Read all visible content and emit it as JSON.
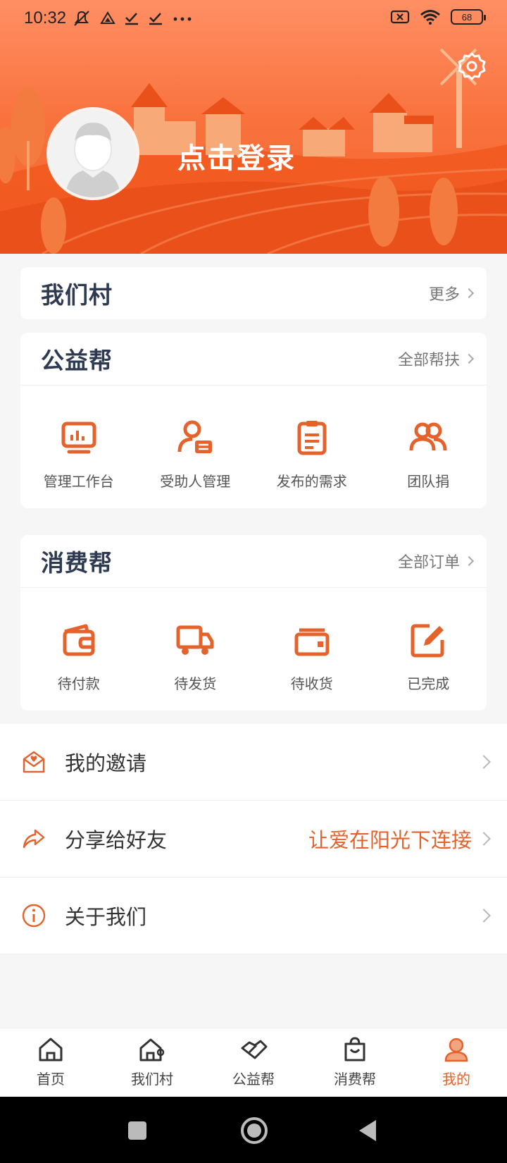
{
  "status_bar": {
    "time": "10:32",
    "battery": "68"
  },
  "profile": {
    "login_label": "点击登录"
  },
  "village_card": {
    "title": "我们村",
    "more": "更多"
  },
  "charity_card": {
    "title": "公益帮",
    "more": "全部帮扶",
    "items": [
      {
        "label": "管理工作台",
        "icon": "dashboard-icon"
      },
      {
        "label": "受助人管理",
        "icon": "beneficiary-icon"
      },
      {
        "label": "发布的需求",
        "icon": "clipboard-icon"
      },
      {
        "label": "团队捐",
        "icon": "team-icon"
      }
    ]
  },
  "consume_card": {
    "title": "消费帮",
    "more": "全部订单",
    "items": [
      {
        "label": "待付款",
        "icon": "wallet-icon"
      },
      {
        "label": "待发货",
        "icon": "truck-icon"
      },
      {
        "label": "待收货",
        "icon": "inbox-icon"
      },
      {
        "label": "已完成",
        "icon": "edit-icon"
      }
    ]
  },
  "menu": [
    {
      "label": "我的邀请",
      "extra": "",
      "icon": "invitation-icon"
    },
    {
      "label": "分享给好友",
      "extra": "让爱在阳光下连接",
      "icon": "share-icon"
    },
    {
      "label": "关于我们",
      "extra": "",
      "icon": "info-icon"
    }
  ],
  "tabs": [
    {
      "label": "首页",
      "icon": "home-icon"
    },
    {
      "label": "我们村",
      "icon": "village-icon"
    },
    {
      "label": "公益帮",
      "icon": "charity-icon"
    },
    {
      "label": "消费帮",
      "icon": "shopping-bag-icon"
    },
    {
      "label": "我的",
      "icon": "profile-icon",
      "active": true
    }
  ],
  "colors": {
    "accent": "#e4622b",
    "title": "#2d3a52",
    "header": "#f9733f"
  }
}
